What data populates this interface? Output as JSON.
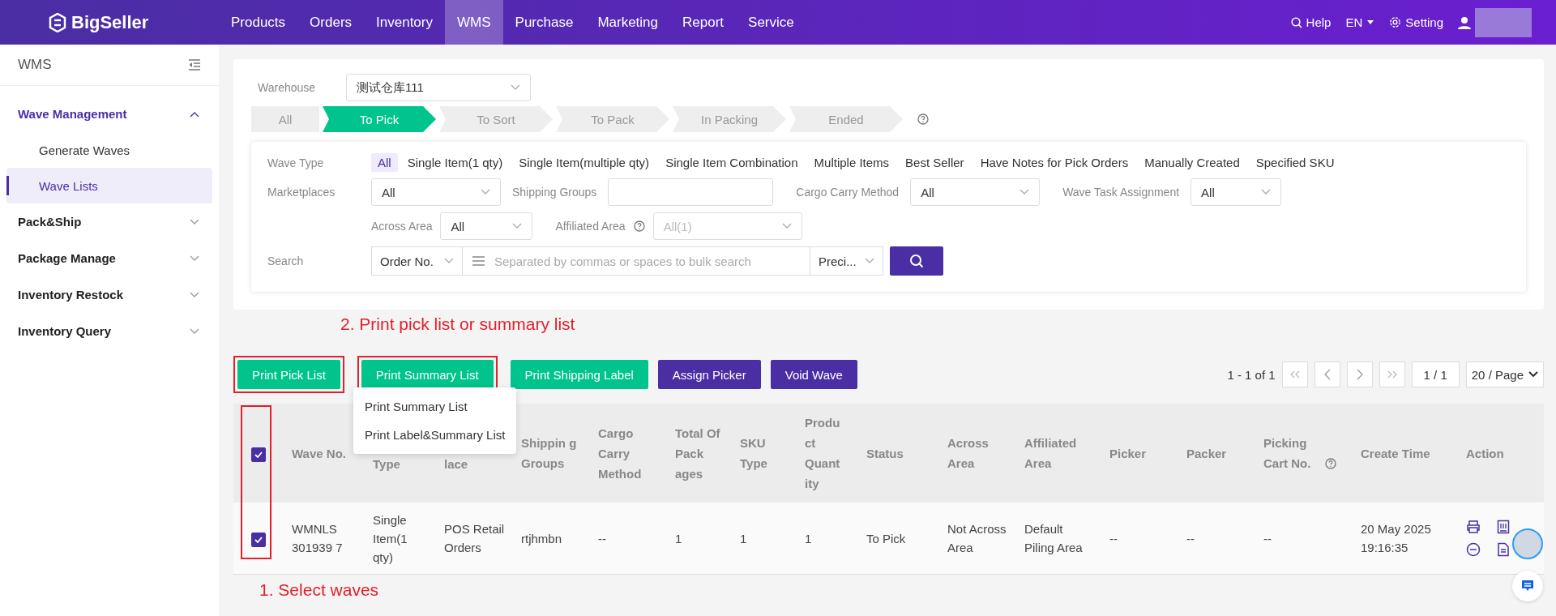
{
  "nav": {
    "logo": "BigSeller",
    "items": [
      {
        "label": "Products",
        "selected": false
      },
      {
        "label": "Orders",
        "selected": false
      },
      {
        "label": "Inventory",
        "selected": false
      },
      {
        "label": "WMS",
        "selected": true
      },
      {
        "label": "Purchase",
        "selected": false
      },
      {
        "label": "Marketing",
        "selected": false
      },
      {
        "label": "Report",
        "selected": false
      },
      {
        "label": "Service",
        "selected": false
      }
    ],
    "help": "Help",
    "language": "EN",
    "setting": "Setting"
  },
  "sidebar": {
    "title": "WMS",
    "groups": [
      {
        "label": "Wave Management",
        "expanded": true,
        "children": [
          {
            "label": "Generate Waves",
            "selected": false
          },
          {
            "label": "Wave Lists",
            "selected": true
          }
        ]
      },
      {
        "label": "Pack&Ship",
        "expanded": false
      },
      {
        "label": "Package Manage",
        "expanded": false
      },
      {
        "label": "Inventory Restock",
        "expanded": false
      },
      {
        "label": "Inventory Query",
        "expanded": false
      }
    ]
  },
  "filters": {
    "warehouse_label": "Warehouse",
    "warehouse": "测试仓库111",
    "steps": [
      {
        "label": "All",
        "selected": false
      },
      {
        "label": "To Pick",
        "selected": true
      },
      {
        "label": "To Sort",
        "selected": false
      },
      {
        "label": "To Pack",
        "selected": false
      },
      {
        "label": "In Packing",
        "selected": false
      },
      {
        "label": "Ended",
        "selected": false
      }
    ],
    "wave_type_label": "Wave Type",
    "wave_types": [
      {
        "label": "All",
        "selected": true
      },
      {
        "label": "Single Item(1 qty)",
        "selected": false
      },
      {
        "label": "Single Item(multiple qty)",
        "selected": false
      },
      {
        "label": "Single Item Combination",
        "selected": false
      },
      {
        "label": "Multiple Items",
        "selected": false
      },
      {
        "label": "Best Seller",
        "selected": false
      },
      {
        "label": "Have Notes for Pick Orders",
        "selected": false
      },
      {
        "label": "Manually Created",
        "selected": false
      },
      {
        "label": "Specified SKU",
        "selected": false
      }
    ],
    "marketplaces_label": "Marketplaces",
    "marketplaces": "All",
    "shipping_groups_label": "Shipping Groups",
    "cargo_label": "Cargo Carry Method",
    "cargo": "All",
    "assignment_label": "Wave Task Assignment",
    "assignment": "All",
    "across_label": "Across Area",
    "across": "All",
    "affiliated_label": "Affiliated Area",
    "affiliated": "All(1)",
    "search_label": "Search",
    "search_field": "Order No.",
    "search_placeholder": "Separated by commas or spaces to bulk search",
    "match": "Preci..."
  },
  "toolbar": {
    "buttons": [
      {
        "label": "Print Pick List",
        "kind": "green",
        "highlighted": true
      },
      {
        "label": "Print Summary List",
        "kind": "green",
        "highlighted": true
      },
      {
        "label": "Print Shipping Label",
        "kind": "green",
        "highlighted": false
      },
      {
        "label": "Assign Picker",
        "kind": "purple",
        "highlighted": false
      },
      {
        "label": "Void Wave",
        "kind": "purple",
        "highlighted": false
      }
    ],
    "menu": [
      "Print Summary List",
      "Print Label&Summary List"
    ],
    "pagination": {
      "range": "1 - 1 of 1",
      "page": "1 / 1",
      "page_size": "20 / Page"
    }
  },
  "table": {
    "all_checked": true,
    "columns": [
      "Wave No.",
      "Type",
      "lace",
      "Shippin g Groups",
      "Cargo Carry Method",
      "Total Of Pack ages",
      "SKU Type",
      "Produ ct Quant ity",
      "Status",
      "Across Area",
      "Affiliated Area",
      "Picker",
      "Packer",
      "Picking Cart No.",
      "Create Time",
      "Action"
    ],
    "rows": [
      {
        "checked": true,
        "cells": [
          "WMNLS 301939 7",
          "Single Item(1 qty)",
          "POS Retail Orders",
          "rtjhmbn",
          "--",
          "1",
          "1",
          "1",
          "To Pick",
          "Not Across Area",
          "Default Piling Area",
          "--",
          "--",
          "--",
          "20 May 2025 19:16:35"
        ]
      }
    ]
  },
  "annotations": [
    "2. Print pick list or summary list",
    "1. Select waves"
  ]
}
